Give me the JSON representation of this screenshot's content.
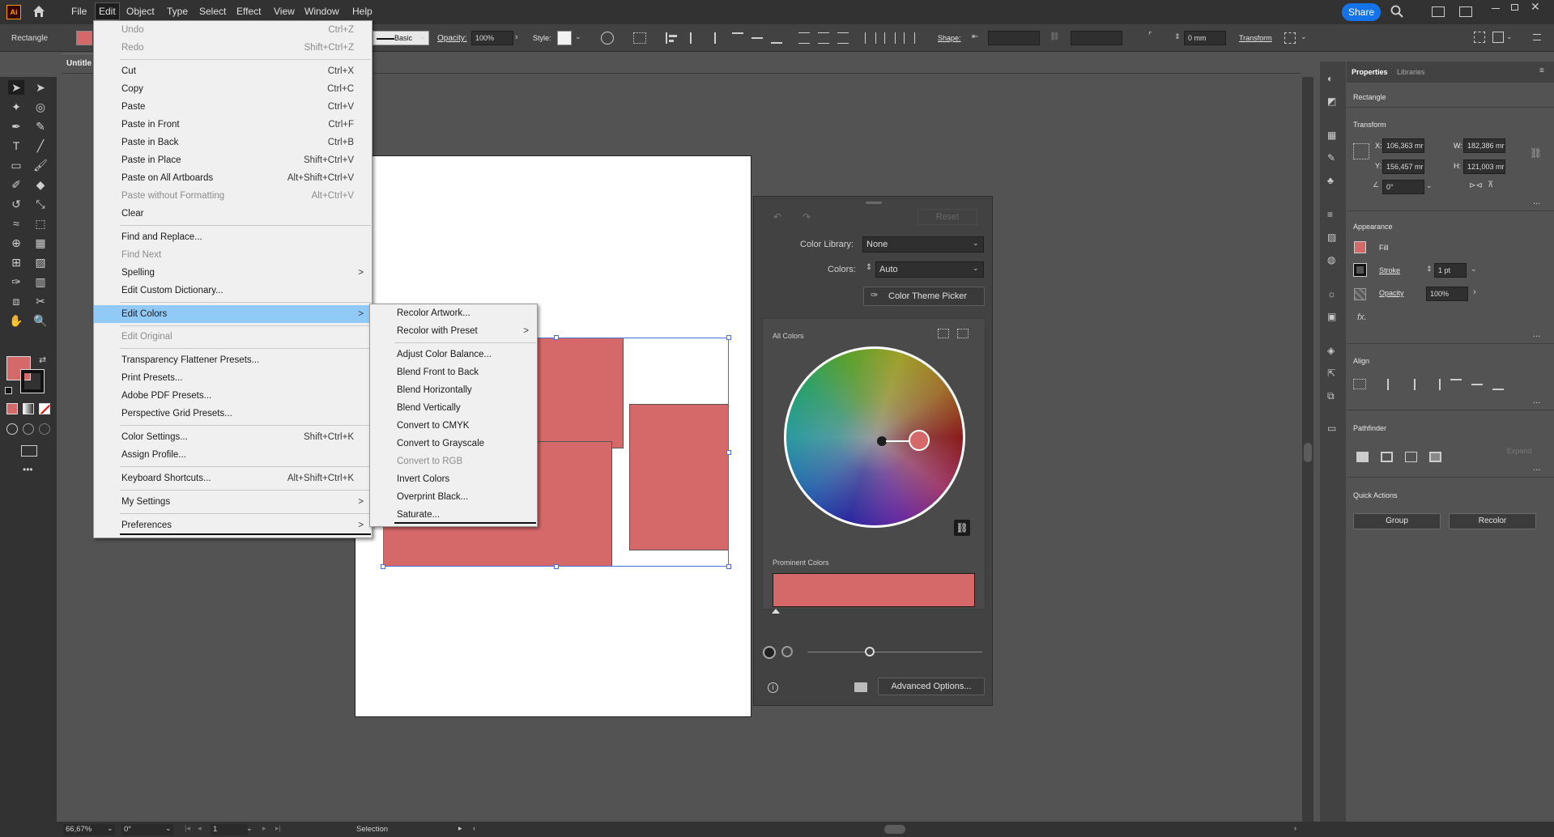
{
  "app": {
    "logo": "Ai",
    "home_icon": "home-icon"
  },
  "menubar": {
    "items": [
      "File",
      "Edit",
      "Object",
      "Type",
      "Select",
      "Effect",
      "View",
      "Window",
      "Help"
    ],
    "share_label": "Share"
  },
  "control_bar": {
    "object_type": "Rectangle",
    "brush": "Basic",
    "opacity_label": "Opacity:",
    "opacity_value": "100%",
    "style_label": "Style:",
    "shape_label": "Shape:",
    "corner_value": "0 mm",
    "transform_label": "Transform",
    "fill_color": "#d56868"
  },
  "document": {
    "tab_title": "Untitle"
  },
  "edit_menu": {
    "items": [
      {
        "label": "Undo",
        "shortcut": "Ctrl+Z",
        "disabled": true
      },
      {
        "label": "Redo",
        "shortcut": "Shift+Ctrl+Z",
        "disabled": true
      },
      {
        "label": "Cut",
        "shortcut": "Ctrl+X"
      },
      {
        "label": "Copy",
        "shortcut": "Ctrl+C"
      },
      {
        "label": "Paste",
        "shortcut": "Ctrl+V"
      },
      {
        "label": "Paste in Front",
        "shortcut": "Ctrl+F"
      },
      {
        "label": "Paste in Back",
        "shortcut": "Ctrl+B"
      },
      {
        "label": "Paste in Place",
        "shortcut": "Shift+Ctrl+V"
      },
      {
        "label": "Paste on All Artboards",
        "shortcut": "Alt+Shift+Ctrl+V"
      },
      {
        "label": "Paste without Formatting",
        "shortcut": "Alt+Ctrl+V",
        "disabled": true
      },
      {
        "label": "Clear",
        "shortcut": ""
      },
      {
        "label": "Find and Replace...",
        "shortcut": ""
      },
      {
        "label": "Find Next",
        "shortcut": "",
        "disabled": true
      },
      {
        "label": "Spelling",
        "shortcut": ">"
      },
      {
        "label": "Edit Custom Dictionary...",
        "shortcut": ""
      },
      {
        "label": "Edit Colors",
        "shortcut": ">"
      },
      {
        "label": "Edit Original",
        "shortcut": "",
        "disabled": true
      },
      {
        "label": "Transparency Flattener Presets...",
        "shortcut": ""
      },
      {
        "label": "Print Presets...",
        "shortcut": ""
      },
      {
        "label": "Adobe PDF Presets...",
        "shortcut": ""
      },
      {
        "label": "Perspective Grid Presets...",
        "shortcut": ""
      },
      {
        "label": "Color Settings...",
        "shortcut": "Shift+Ctrl+K"
      },
      {
        "label": "Assign Profile...",
        "shortcut": ""
      },
      {
        "label": "Keyboard Shortcuts...",
        "shortcut": "Alt+Shift+Ctrl+K"
      },
      {
        "label": "My Settings",
        "shortcut": ">"
      },
      {
        "label": "Preferences",
        "shortcut": ">"
      }
    ]
  },
  "edit_colors_submenu": {
    "items": [
      {
        "label": "Recolor Artwork...",
        "disabled": false
      },
      {
        "label": "Recolor with Preset",
        "arrow": ">"
      },
      {
        "label": "Adjust Color Balance..."
      },
      {
        "label": "Blend Front to Back"
      },
      {
        "label": "Blend Horizontally"
      },
      {
        "label": "Blend Vertically"
      },
      {
        "label": "Convert to CMYK"
      },
      {
        "label": "Convert to Grayscale"
      },
      {
        "label": "Convert to RGB",
        "disabled": true
      },
      {
        "label": "Invert Colors"
      },
      {
        "label": "Overprint Black..."
      },
      {
        "label": "Saturate..."
      }
    ]
  },
  "recolor_panel": {
    "reset_label": "Reset",
    "color_library_label": "Color Library:",
    "color_library_value": "None",
    "colors_label": "Colors:",
    "colors_value": "Auto",
    "theme_picker_label": "Color Theme Picker",
    "all_colors_label": "All Colors",
    "prominent_label": "Prominent Colors",
    "advanced_label": "Advanced Options...",
    "swatch_color": "#d56868"
  },
  "properties": {
    "tabs": [
      "Properties",
      "Libraries"
    ],
    "object": "Rectangle",
    "transform_title": "Transform",
    "x_label": "X:",
    "x_value": "106,363 mr",
    "y_label": "Y:",
    "y_value": "156,457 mr",
    "w_label": "W:",
    "w_value": "182,386 mr",
    "h_label": "H:",
    "h_value": "121,003 mr",
    "angle_value": "0°",
    "appearance_title": "Appearance",
    "fill_label": "Fill",
    "stroke_label": "Stroke",
    "stroke_value": "1 pt",
    "opacity_label": "Opacity",
    "opacity_value": "100%",
    "fx_label": "fx.",
    "align_title": "Align",
    "pathfinder_title": "Pathfinder",
    "expand_label": "Expand",
    "quick_actions_title": "Quick Actions",
    "group_label": "Group",
    "recolor_label": "Recolor",
    "more": "..."
  },
  "statusbar": {
    "zoom": "66,67%",
    "rotation": "0°",
    "artboard": "1",
    "tool": "Selection"
  }
}
